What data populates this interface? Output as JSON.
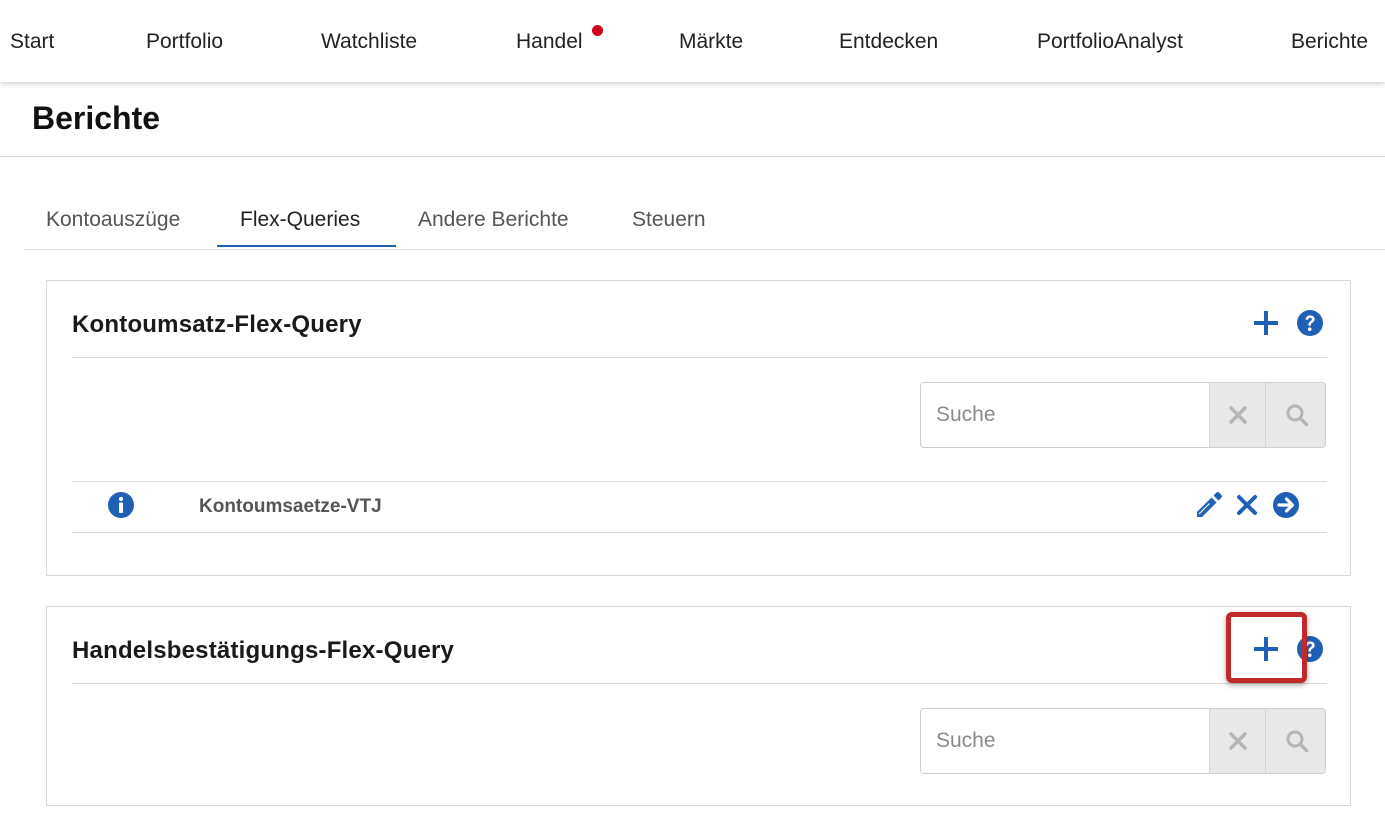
{
  "nav": {
    "items": [
      {
        "label": "Start"
      },
      {
        "label": "Portfolio"
      },
      {
        "label": "Watchliste"
      },
      {
        "label": "Handel",
        "has_notification": true
      },
      {
        "label": "Märkte"
      },
      {
        "label": "Entdecken"
      },
      {
        "label": "PortfolioAnalyst"
      },
      {
        "label": "Berichte"
      }
    ]
  },
  "page": {
    "title": "Berichte"
  },
  "tabs": {
    "items": [
      {
        "label": "Kontoauszüge"
      },
      {
        "label": "Flex-Queries",
        "active": true
      },
      {
        "label": "Andere Berichte"
      },
      {
        "label": "Steuern"
      }
    ]
  },
  "panels": [
    {
      "title": "Kontoumsatz-Flex-Query",
      "search_placeholder": "Suche",
      "rows": [
        {
          "name": "Kontoumsaetze-VTJ"
        }
      ]
    },
    {
      "title": "Handelsbestätigungs-Flex-Query",
      "search_placeholder": "Suche",
      "rows": []
    }
  ],
  "colors": {
    "accent_blue": "#1f5fb4",
    "notification_red": "#d0021b",
    "highlight_red": "#c12a2a"
  },
  "icons": [
    "plus-icon",
    "help-icon",
    "clear-icon",
    "search-icon",
    "info-icon",
    "edit-icon",
    "delete-icon",
    "go-icon"
  ]
}
